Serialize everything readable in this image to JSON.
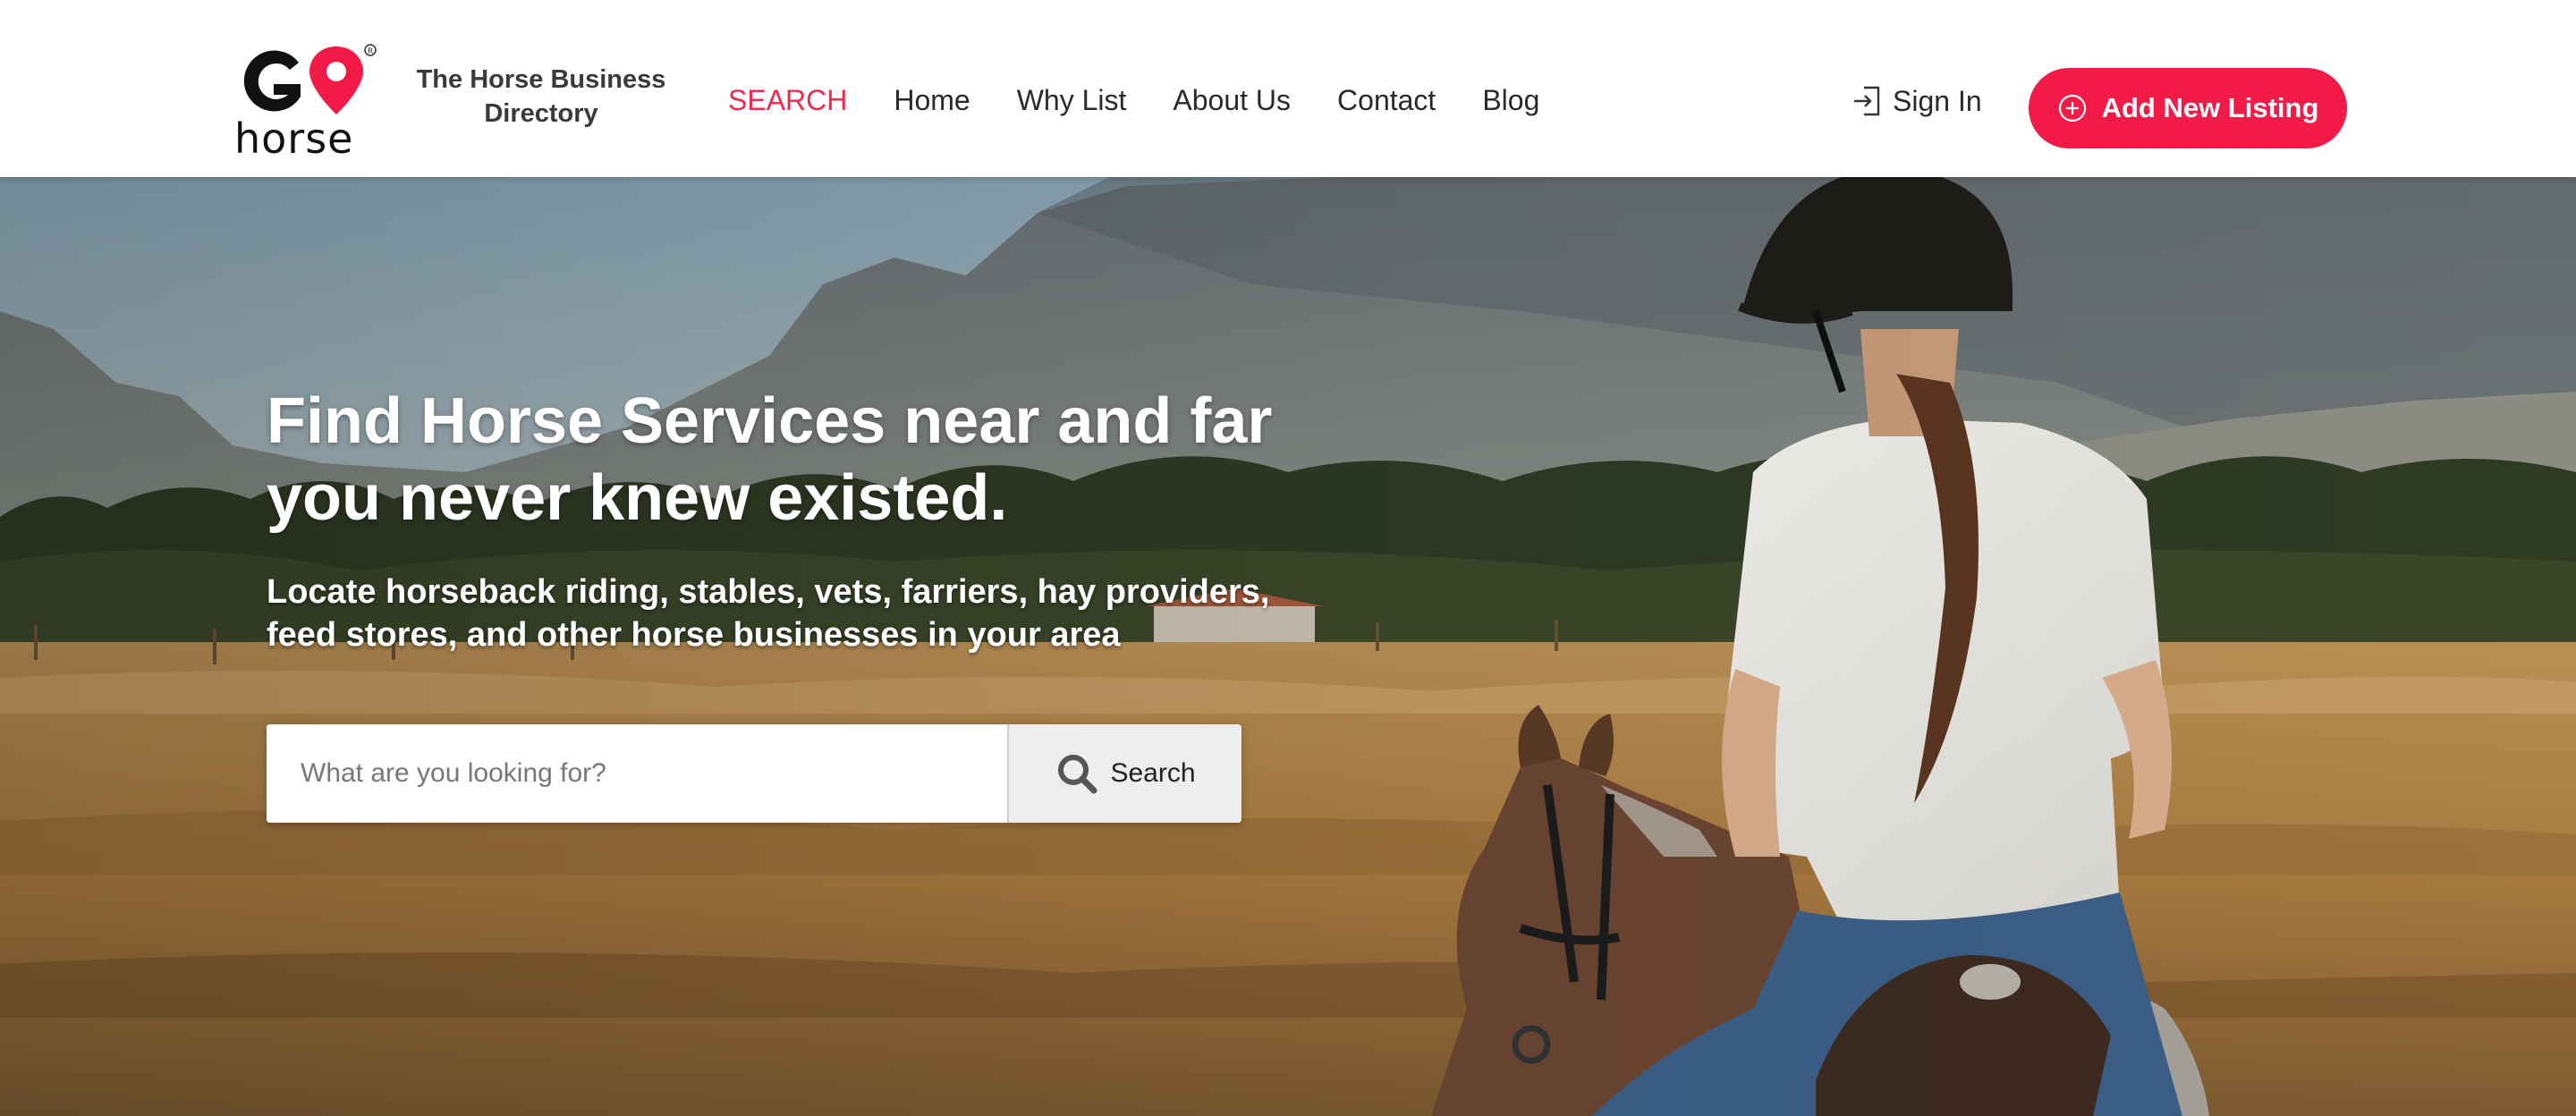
{
  "brand": {
    "logo_letters": "GO",
    "logo_word": "horse",
    "tagline": "The Horse Business Directory",
    "accent": "#f21a47"
  },
  "nav": {
    "items": [
      {
        "label": "SEARCH",
        "active": true
      },
      {
        "label": "Home"
      },
      {
        "label": "Why List"
      },
      {
        "label": "About Us"
      },
      {
        "label": "Contact"
      },
      {
        "label": "Blog"
      }
    ]
  },
  "header": {
    "signin_label": "Sign In",
    "signin_icon": "sign-in-icon",
    "add_listing_label": "Add New Listing",
    "add_listing_icon": "plus-circle-icon"
  },
  "hero": {
    "title": "Find Horse Services near and far you never knew existed.",
    "subtitle": "Locate horseback riding,  stables, vets, farriers, hay providers, feed stores, and other horse businesses in your area",
    "search": {
      "placeholder": "What are you looking for?",
      "value": "",
      "button_label": "Search",
      "button_icon": "search-icon"
    }
  }
}
